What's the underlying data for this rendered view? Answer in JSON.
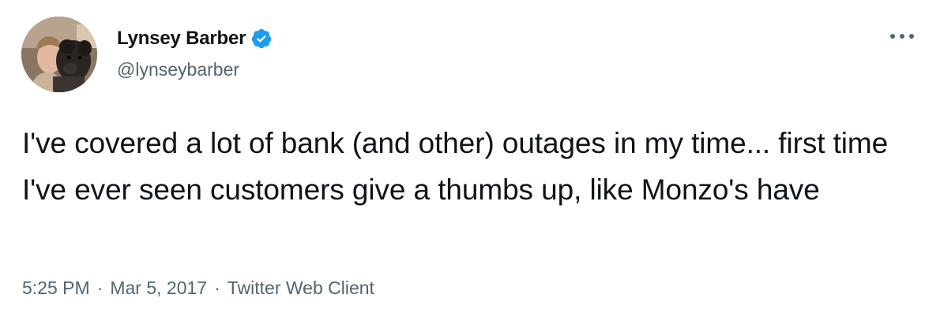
{
  "author": {
    "display_name": "Lynsey Barber",
    "handle": "@lynseybarber",
    "verified": true,
    "avatar_icon": "profile-photo-with-dog"
  },
  "tweet": {
    "text": "I've covered a lot of bank (and other) outages in my time... first time I've ever seen customers give a thumbs up, like Monzo's have"
  },
  "meta": {
    "time": "5:25 PM",
    "separator": "·",
    "date": "Mar 5, 2017",
    "client": "Twitter Web Client"
  },
  "icons": {
    "verified": "verified-badge-icon",
    "more": "more-options-icon"
  },
  "colors": {
    "text_primary": "#0f1419",
    "text_secondary": "#536471",
    "verified_blue": "#1d9bf0"
  }
}
